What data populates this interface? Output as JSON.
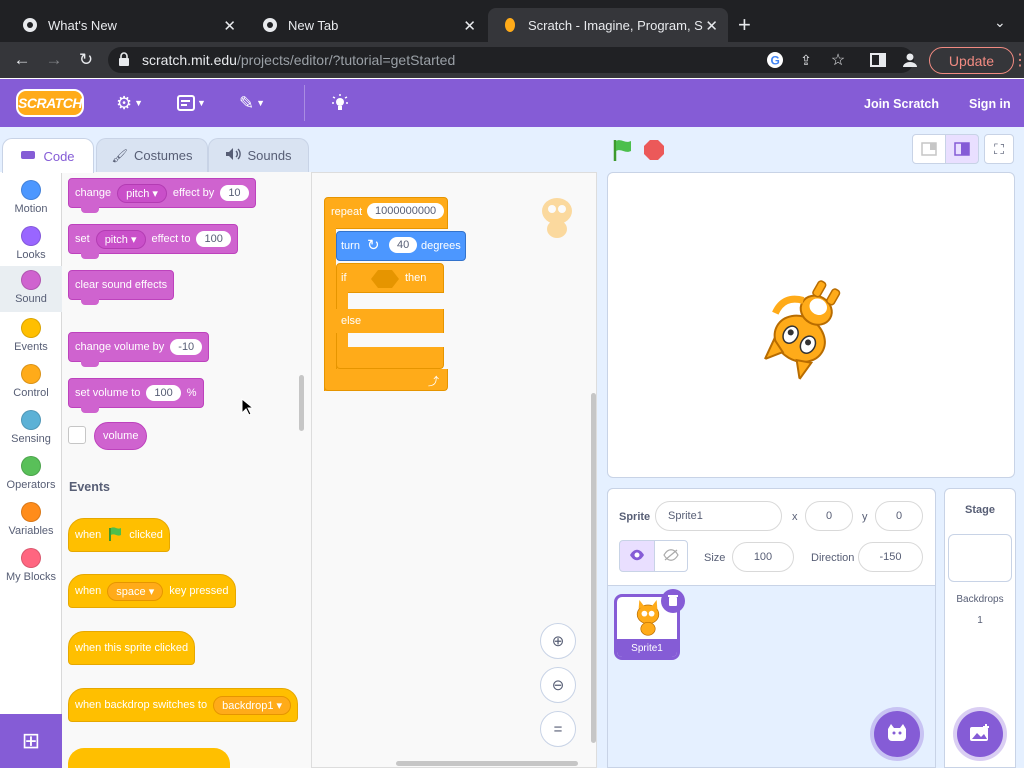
{
  "browser": {
    "tabs": [
      {
        "title": "What's New",
        "active": false
      },
      {
        "title": "New Tab",
        "active": false
      },
      {
        "title": "Scratch - Imagine, Program, Sh",
        "active": true
      }
    ],
    "url_host": "scratch.mit.edu",
    "url_path": "/projects/editor/?tutorial=getStarted",
    "update_label": "Update"
  },
  "menubar": {
    "logo": "SCRATCH",
    "join": "Join Scratch",
    "signin": "Sign in"
  },
  "editor_tabs": [
    "Code",
    "Costumes",
    "Sounds"
  ],
  "categories": [
    {
      "label": "Motion",
      "color": "#4c97ff"
    },
    {
      "label": "Looks",
      "color": "#9966ff"
    },
    {
      "label": "Sound",
      "color": "#cf63cf"
    },
    {
      "label": "Events",
      "color": "#ffbf00"
    },
    {
      "label": "Control",
      "color": "#ffab19"
    },
    {
      "label": "Sensing",
      "color": "#5cb1d6"
    },
    {
      "label": "Operators",
      "color": "#59c059"
    },
    {
      "label": "Variables",
      "color": "#ff8c1a"
    },
    {
      "label": "My Blocks",
      "color": "#ff6680"
    }
  ],
  "palette": {
    "change_effect": {
      "a": "change",
      "opt": "pitch",
      "b": "effect by",
      "val": "10"
    },
    "set_effect": {
      "a": "set",
      "opt": "pitch",
      "b": "effect to",
      "val": "100"
    },
    "clear_effects": "clear sound effects",
    "change_volume": {
      "a": "change volume by",
      "val": "-10"
    },
    "set_volume": {
      "a": "set volume to",
      "val": "100",
      "unit": "%"
    },
    "volume_reporter": "volume",
    "events_heading": "Events",
    "when_flag": {
      "a": "when",
      "b": "clicked"
    },
    "when_key": {
      "a": "when",
      "opt": "space",
      "b": "key pressed"
    },
    "when_sprite": "when this sprite clicked",
    "when_backdrop": {
      "a": "when backdrop switches to",
      "opt": "backdrop1"
    }
  },
  "script": {
    "repeat_label": "repeat",
    "repeat_count": "1000000000",
    "turn_label": "turn",
    "turn_value": "40",
    "turn_unit": "degrees",
    "if_label": "if",
    "then_label": "then",
    "else_label": "else"
  },
  "sprite_info": {
    "sprite_label": "Sprite",
    "sprite_name": "Sprite1",
    "x_label": "x",
    "x_value": "0",
    "y_label": "y",
    "y_value": "0",
    "size_label": "Size",
    "size_value": "100",
    "direction_label": "Direction",
    "direction_value": "-150"
  },
  "sprite_list": [
    {
      "name": "Sprite1",
      "selected": true
    }
  ],
  "stage_panel": {
    "title": "Stage",
    "backdrops_label": "Backdrops",
    "backdrops_count": "1"
  },
  "colors": {
    "accent": "#855cd6",
    "sound": "#cf63cf",
    "events": "#ffbf00",
    "control": "#ffab19",
    "motion": "#4c97ff"
  }
}
